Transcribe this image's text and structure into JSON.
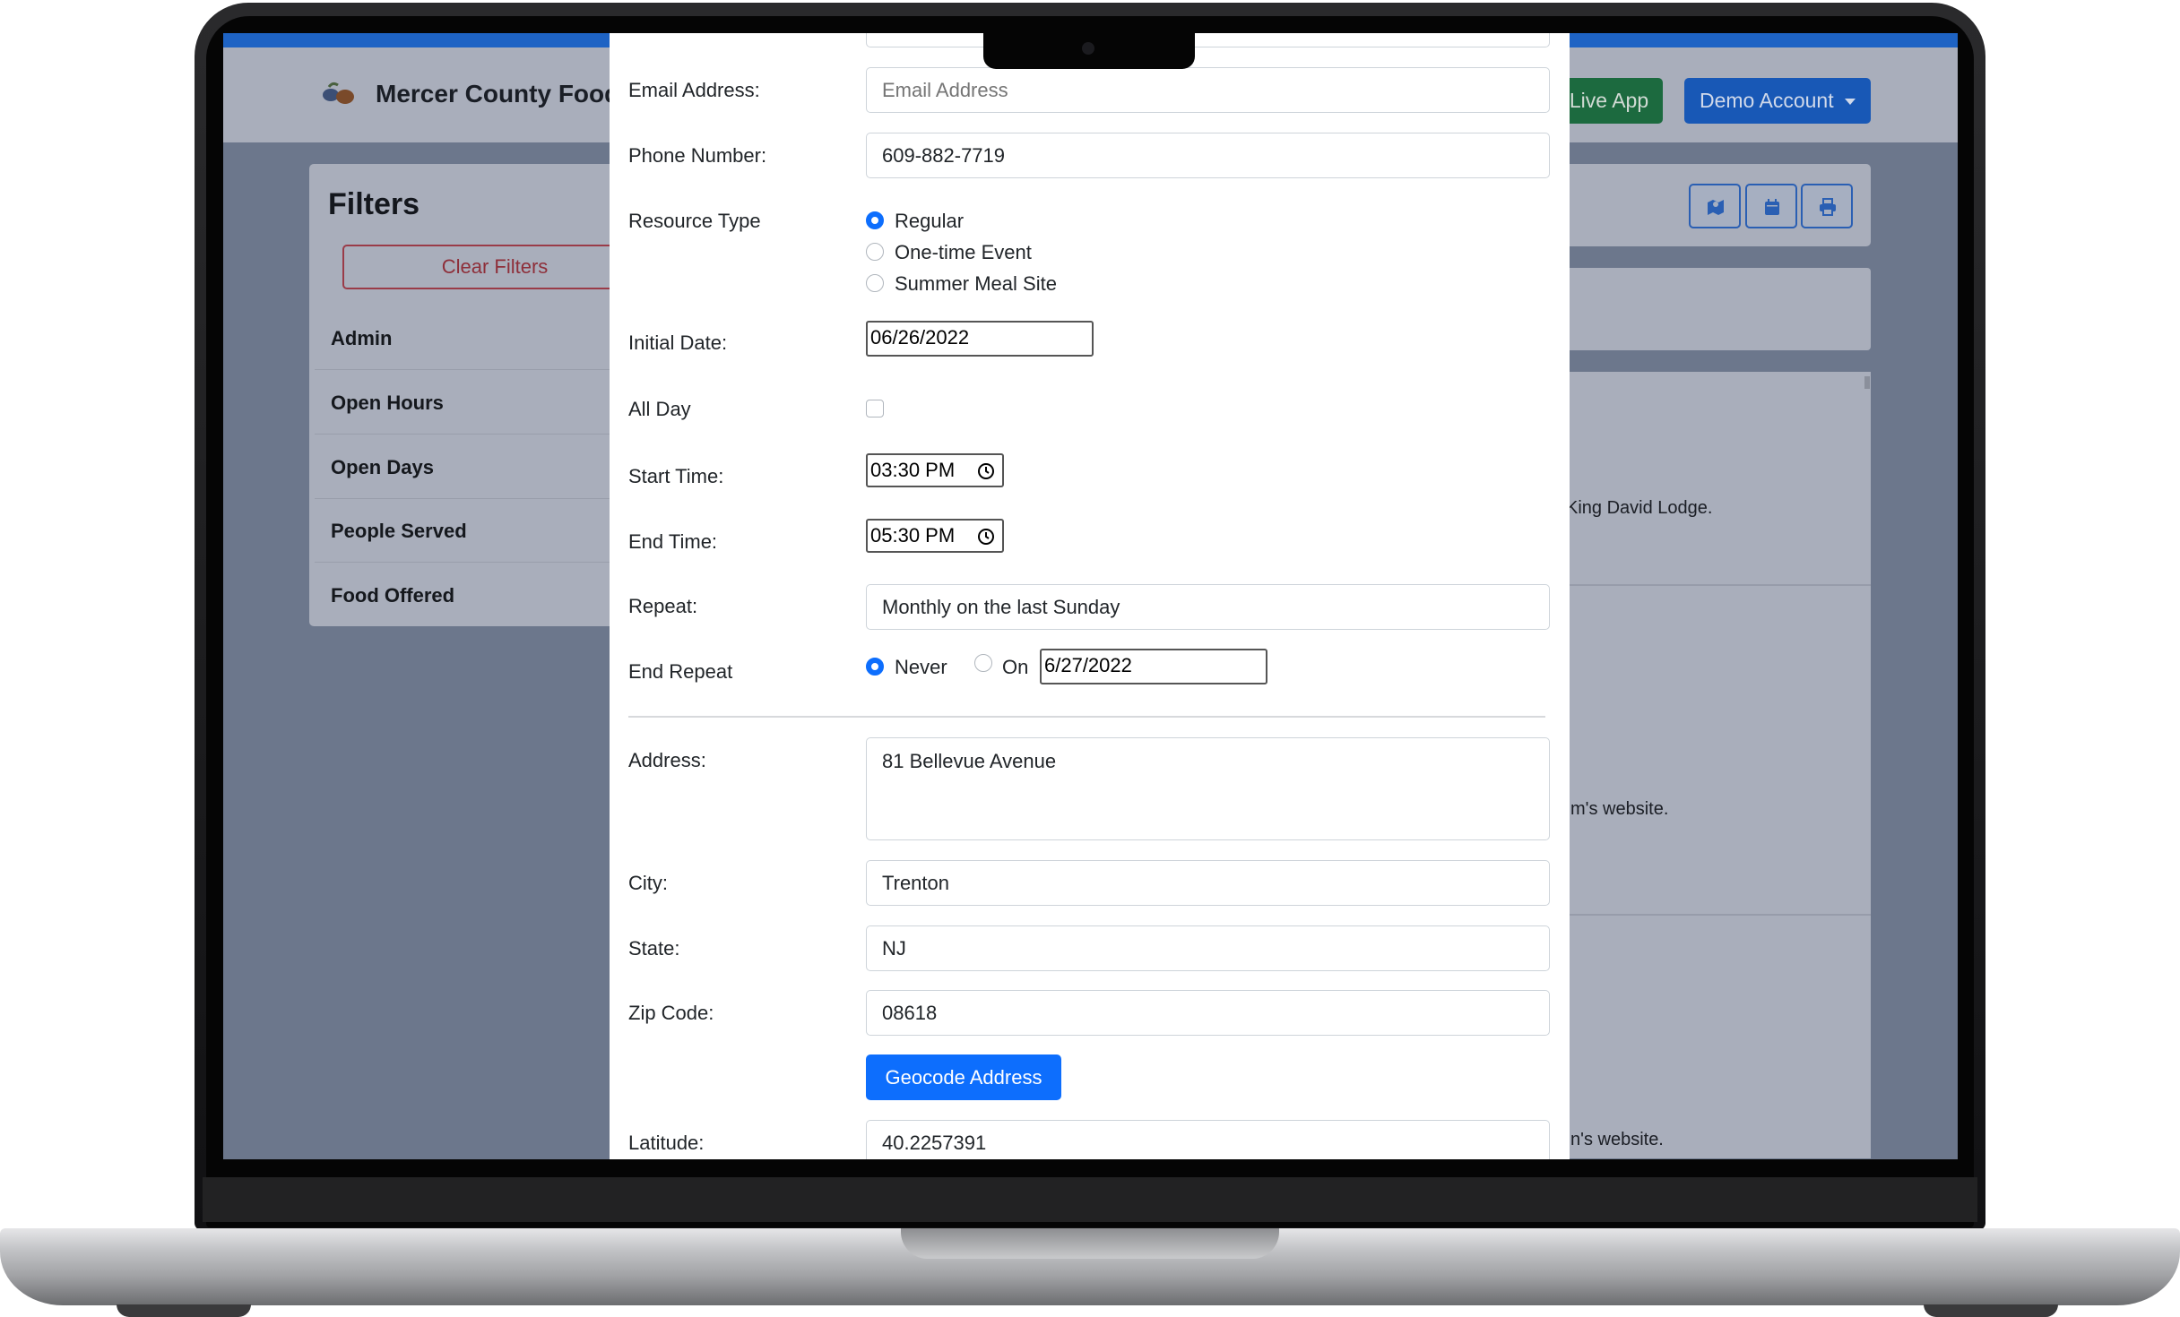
{
  "app": {
    "brand": "Mercer County Food",
    "live_app_label": "Live App",
    "account_label": "Demo Account"
  },
  "filters": {
    "title": "Filters",
    "clear_label": "Clear Filters",
    "items": [
      {
        "label": "Admin"
      },
      {
        "label": "Open Hours"
      },
      {
        "label": "Open Days"
      },
      {
        "label": "People Served"
      },
      {
        "label": "Food Offered"
      }
    ]
  },
  "toolbar": {
    "icons": [
      "map-icon",
      "calendar-icon",
      "print-icon"
    ]
  },
  "background_list": {
    "snippets": [
      "King David Lodge.",
      "m's website.",
      "n's website."
    ]
  },
  "form": {
    "email": {
      "label": "Email Address:",
      "placeholder": "Email Address",
      "value": ""
    },
    "phone": {
      "label": "Phone Number:",
      "value": "609-882-7719"
    },
    "resource_type": {
      "label": "Resource Type",
      "options": [
        {
          "label": "Regular",
          "selected": true
        },
        {
          "label": "One-time Event",
          "selected": false
        },
        {
          "label": "Summer Meal Site",
          "selected": false
        }
      ]
    },
    "initial_date": {
      "label": "Initial Date:",
      "value": "06/26/2022"
    },
    "all_day": {
      "label": "All Day",
      "checked": false
    },
    "start_time": {
      "label": "Start Time:",
      "value": "03:30 PM"
    },
    "end_time": {
      "label": "End Time:",
      "value": "05:30 PM"
    },
    "repeat": {
      "label": "Repeat:",
      "value": "Monthly on the last Sunday"
    },
    "end_repeat": {
      "label": "End Repeat",
      "never_label": "Never",
      "on_label": "On",
      "selected": "never",
      "on_date": "6/27/2022"
    },
    "address": {
      "label": "Address:",
      "value": "81 Bellevue Avenue"
    },
    "city": {
      "label": "City:",
      "value": "Trenton"
    },
    "state": {
      "label": "State:",
      "value": "NJ"
    },
    "zip": {
      "label": "Zip Code:",
      "value": "08618"
    },
    "geocode_label": "Geocode Address",
    "latitude": {
      "label": "Latitude:",
      "value": "40.2257391"
    }
  },
  "colors": {
    "primary": "#0d6efd",
    "success": "#198754",
    "danger": "#dc3545"
  }
}
